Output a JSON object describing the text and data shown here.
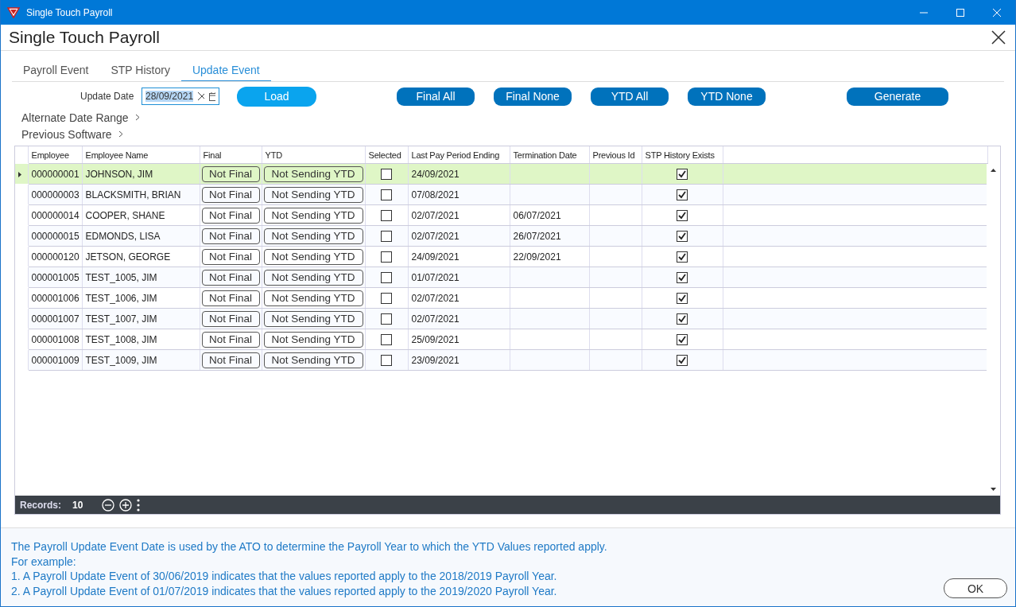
{
  "window": {
    "title": "Single Touch Payroll"
  },
  "header": {
    "title": "Single Touch Payroll"
  },
  "tabs": [
    {
      "label": "Payroll Event",
      "selected": false
    },
    {
      "label": "STP History",
      "selected": false
    },
    {
      "label": "Update Event",
      "selected": true
    }
  ],
  "update_date": {
    "label": "Update Date",
    "value": "28/09/2021"
  },
  "load_button": "Load",
  "action_buttons": [
    "Final All",
    "Final None",
    "YTD All",
    "YTD None"
  ],
  "generate_button": "Generate",
  "expanders": [
    "Alternate Date Range",
    "Previous Software"
  ],
  "table": {
    "columns": [
      "Employee",
      "Employee Name",
      "Final",
      "YTD",
      "Selected",
      "Last Pay Period Ending",
      "Termination Date",
      "Previous Id",
      "STP History Exists"
    ],
    "rows": [
      {
        "employee": "000000001",
        "name": "JOHNSON, JIM",
        "final": "Not Final",
        "ytd": "Not Sending YTD",
        "checked": false,
        "last_pay": "24/09/2021",
        "termination": "",
        "stp_history": true,
        "selected": true
      },
      {
        "employee": "000000003",
        "name": "BLACKSMITH, BRIAN",
        "final": "Not Final",
        "ytd": "Not Sending YTD",
        "checked": false,
        "last_pay": "07/08/2021",
        "termination": "",
        "stp_history": true,
        "selected": false
      },
      {
        "employee": "000000014",
        "name": "COOPER, SHANE",
        "final": "Not Final",
        "ytd": "Not Sending YTD",
        "checked": false,
        "last_pay": "02/07/2021",
        "termination": "06/07/2021",
        "stp_history": true,
        "selected": false
      },
      {
        "employee": "000000015",
        "name": "EDMONDS, LISA",
        "final": "Not Final",
        "ytd": "Not Sending YTD",
        "checked": false,
        "last_pay": "02/07/2021",
        "termination": "26/07/2021",
        "stp_history": true,
        "selected": false
      },
      {
        "employee": "000000120",
        "name": "JETSON, GEORGE",
        "final": "Not Final",
        "ytd": "Not Sending YTD",
        "checked": false,
        "last_pay": "24/09/2021",
        "termination": "22/09/2021",
        "stp_history": true,
        "selected": false
      },
      {
        "employee": "000001005",
        "name": "TEST_1005, JIM",
        "final": "Not Final",
        "ytd": "Not Sending YTD",
        "checked": false,
        "last_pay": "01/07/2021",
        "termination": "",
        "stp_history": true,
        "selected": false
      },
      {
        "employee": "000001006",
        "name": "TEST_1006, JIM",
        "final": "Not Final",
        "ytd": "Not Sending YTD",
        "checked": false,
        "last_pay": "02/07/2021",
        "termination": "",
        "stp_history": true,
        "selected": false
      },
      {
        "employee": "000001007",
        "name": "TEST_1007, JIM",
        "final": "Not Final",
        "ytd": "Not Sending YTD",
        "checked": false,
        "last_pay": "02/07/2021",
        "termination": "",
        "stp_history": true,
        "selected": false
      },
      {
        "employee": "000001008",
        "name": "TEST_1008, JIM",
        "final": "Not Final",
        "ytd": "Not Sending YTD",
        "checked": false,
        "last_pay": "25/09/2021",
        "termination": "",
        "stp_history": true,
        "selected": false
      },
      {
        "employee": "000001009",
        "name": "TEST_1009, JIM",
        "final": "Not Final",
        "ytd": "Not Sending YTD",
        "checked": false,
        "last_pay": "23/09/2021",
        "termination": "",
        "stp_history": true,
        "selected": false
      }
    ]
  },
  "grid_footer": {
    "label": "Records:",
    "count": "10"
  },
  "info_lines": [
    "The Payroll Update Event Date is used by the ATO to determine the Payroll Year to which the YTD Values reported apply.",
    "For example:",
    "1. A Payroll Update Event of 30/06/2019 indicates that the values reported apply to the 2018/2019 Payroll Year.",
    "2. A Payroll Update Event of 01/07/2019 indicates that the values reported apply to the 2019/2020 Payroll Year."
  ],
  "ok_button": "OK"
}
